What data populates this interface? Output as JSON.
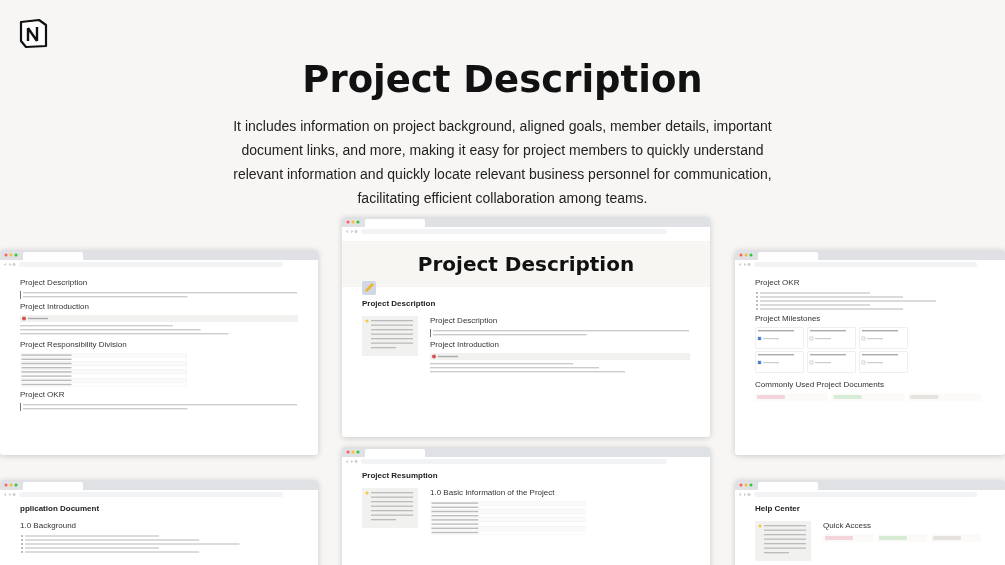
{
  "title": "Project Description",
  "description": "It includes information on project background, aligned goals, member details, important document links, and more, making it easy for project members to quickly understand relevant information and quickly locate relevant business personnel for communication, facilitating efficient collaboration among teams.",
  "windows": [
    {
      "banner": "Project Description",
      "page_title": "Project Description",
      "sidebar": true,
      "sections": [
        {
          "heading": "Project Description",
          "kind": "text"
        },
        {
          "heading": "Project Introduction",
          "kind": "callout"
        }
      ]
    },
    {
      "sections": [
        {
          "heading": "Project Description",
          "kind": "text"
        },
        {
          "heading": "Project Introduction",
          "kind": "callout"
        },
        {
          "heading": "Project Responsibility Division",
          "kind": "table"
        },
        {
          "heading": "Project OKR",
          "kind": "text"
        }
      ]
    },
    {
      "sections": [
        {
          "heading": "Project OKR",
          "kind": "bullets"
        },
        {
          "heading": "Project Milestones",
          "kind": "board"
        },
        {
          "heading": "Commonly Used Project Documents",
          "kind": "tags"
        }
      ]
    },
    {
      "page_title": "Project Resumption",
      "sidebar": true,
      "sections": [
        {
          "heading": "1.0 Basic Information of the Project",
          "kind": "table"
        }
      ]
    },
    {
      "page_title": "pplication Document",
      "sections": [
        {
          "heading": "1.0 Background",
          "kind": "bullets"
        }
      ]
    },
    {
      "page_title": "Help Center",
      "sidebar": true,
      "sections": [
        {
          "heading": "Quick Access",
          "kind": "tags"
        }
      ]
    }
  ]
}
